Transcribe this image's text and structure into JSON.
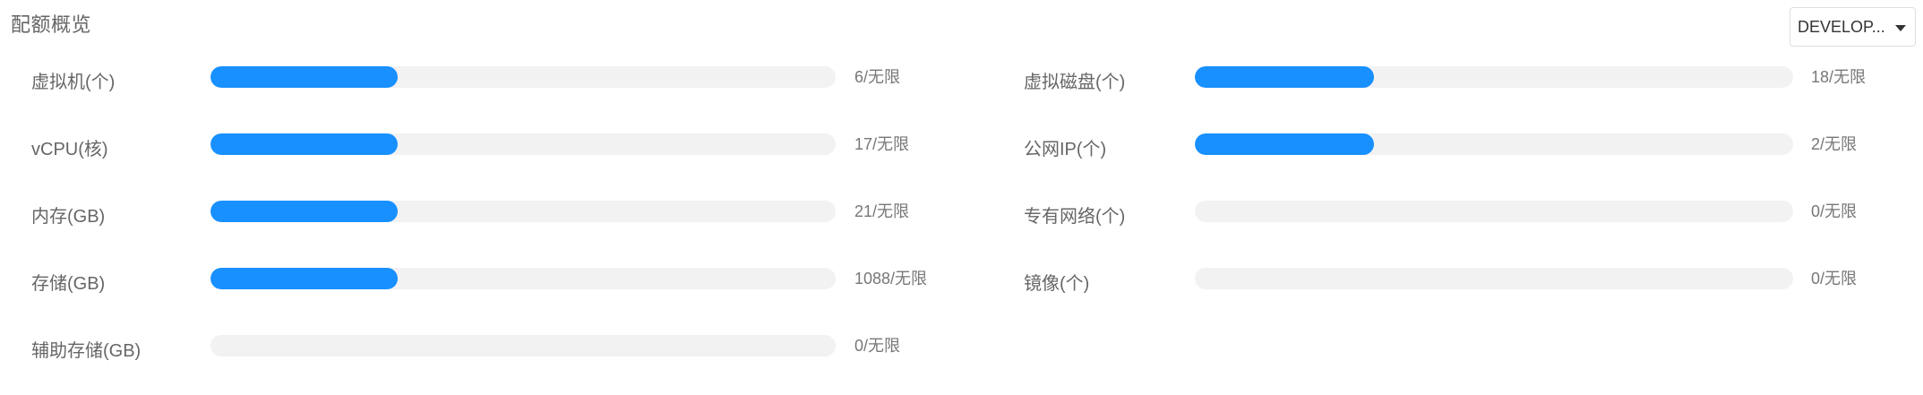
{
  "header": {
    "title": "配额概览",
    "environment_select": {
      "value": "DEVELOP..."
    }
  },
  "quota": {
    "left": [
      {
        "label": "虚拟机(个)",
        "usage": "6/无限",
        "fill_fraction": 0.3
      },
      {
        "label": "vCPU(核)",
        "usage": "17/无限",
        "fill_fraction": 0.3
      },
      {
        "label": "内存(GB)",
        "usage": "21/无限",
        "fill_fraction": 0.3
      },
      {
        "label": "存储(GB)",
        "usage": "1088/无限",
        "fill_fraction": 0.3
      },
      {
        "label": "辅助存储(GB)",
        "usage": "0/无限",
        "fill_fraction": 0
      }
    ],
    "right": [
      {
        "label": "虚拟磁盘(个)",
        "usage": "18/无限",
        "fill_fraction": 0.3
      },
      {
        "label": "公网IP(个)",
        "usage": "2/无限",
        "fill_fraction": 0.3
      },
      {
        "label": "专有网络(个)",
        "usage": "0/无限",
        "fill_fraction": 0
      },
      {
        "label": "镜像(个)",
        "usage": "0/无限",
        "fill_fraction": 0
      }
    ]
  },
  "colors": {
    "progress_fill": "#1890ff",
    "progress_track": "#f2f2f2"
  }
}
